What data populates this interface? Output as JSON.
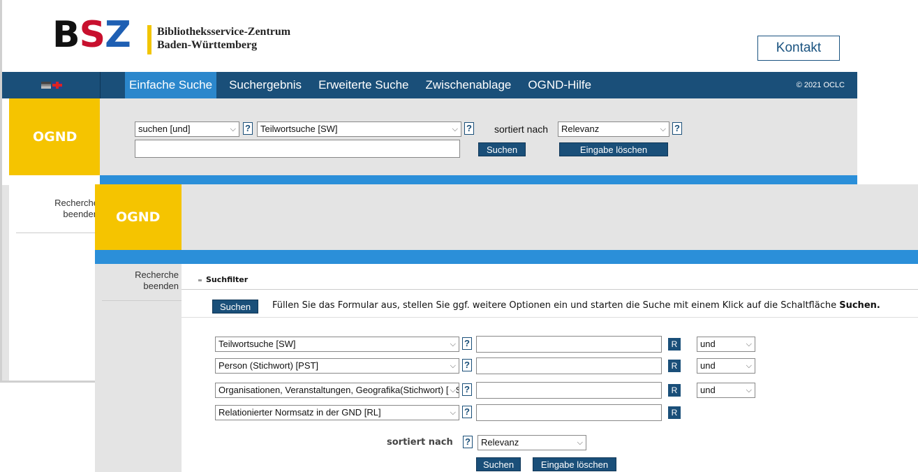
{
  "brand": {
    "logo_letters": [
      "B",
      "S",
      "Z"
    ],
    "name_line1": "Bibliotheksservice-Zentrum",
    "name_line2": "Baden-Württemberg",
    "kontakt_label": "Kontakt"
  },
  "nav": {
    "tabs": [
      "Einfache Suche",
      "Suchergebnis",
      "Erweiterte Suche",
      "Zwischenablage",
      "OGND-Hilfe"
    ],
    "active_tab": "Einfache Suche",
    "copyright": "© 2021 OCLC"
  },
  "ognd_label": "OGND",
  "simple_search": {
    "operator_select": "suchen [und]",
    "field_select": "Teilwortsuche [SW]",
    "sort_label": "sortiert nach",
    "sort_select": "Relevanz",
    "help_glyph": "?",
    "query_value": "",
    "search_button": "Suchen",
    "clear_button": "Eingabe löschen"
  },
  "sidebar": {
    "recherche_line1": "Recherche",
    "recherche_line2": "beenden"
  },
  "advanced_search": {
    "section_title": "Suchfilter",
    "search_button": "Suchen",
    "hint_text": "Füllen Sie das Formular aus, stellen Sie ggf. weitere Optionen ein und starten die Suche mit einem Klick auf die Schaltfläche ",
    "hint_bold": "Suchen.",
    "rows": [
      {
        "field": "Teilwortsuche [SW]",
        "value": "",
        "r_label": "R",
        "operator": "und"
      },
      {
        "field": "Person (Stichwort) [PST]",
        "value": "",
        "r_label": "R",
        "operator": "und"
      },
      {
        "field": "Organisationen, Veranstaltungen, Geografika(Stichwort) [OST]",
        "value": "",
        "r_label": "R",
        "operator": "und"
      },
      {
        "field": "Relationierter Normsatz in der GND [RL]",
        "value": "",
        "r_label": "R",
        "operator": ""
      }
    ],
    "sort_label": "sortiert nach",
    "sort_select": "Relevanz",
    "bottom_search_button": "Suchen",
    "bottom_clear_button": "Eingabe löschen"
  },
  "colors": {
    "navbar": "#1a4f79",
    "active_tab": "#2b87cc",
    "accent_strip": "#2b8fd9",
    "ognd_yellow": "#f5c400",
    "logo_red": "#c8102e",
    "logo_blue": "#1e5fb3"
  },
  "icons": {
    "flag_de": "flag-germany-icon",
    "flag_gb": "flag-uk-icon",
    "chevron": "chevron-down-icon",
    "help": "help-question-icon"
  }
}
